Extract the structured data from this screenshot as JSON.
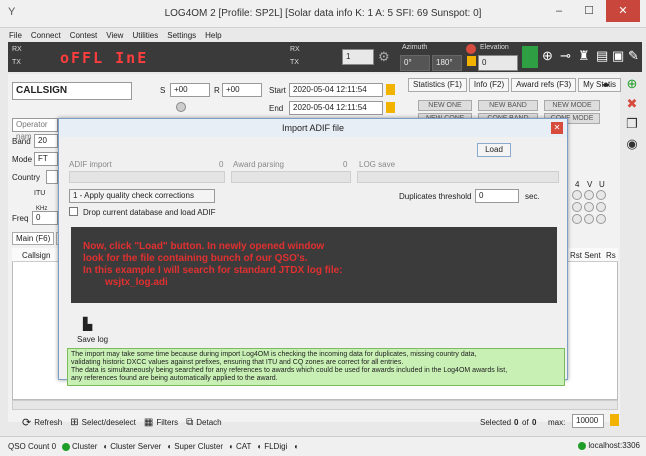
{
  "window": {
    "title": "LOG4OM 2 [Profile: SP2L] [Solar data info K: 1 A: 5 SFI: 69 Sunspot: 0]",
    "app_icon": "Y",
    "min": "–",
    "max": "☐",
    "close": "✕"
  },
  "menu": [
    "File",
    "Connect",
    "Contest",
    "View",
    "Utilities",
    "Settings",
    "Help"
  ],
  "toolbar": {
    "lcd": "oFFL InE",
    "rx": "RX",
    "tx": "TX",
    "step": "1",
    "azimuth_label": "Azimuth",
    "elevation_label": "Elevation",
    "az_1": "0°",
    "az_2": "180°",
    "elev_value": "0"
  },
  "form": {
    "callsign": "CALLSIGN",
    "s_label": "S",
    "s_value": "+00",
    "r_label": "R",
    "r_value": "+00",
    "start_label": "Start",
    "start_value": "2020-05-04 12:11:54",
    "end_label": "End",
    "end_value": "2020-05-04 12:11:54",
    "operator_placeholder": "Operator nam",
    "band_label": "Band",
    "band_value": "20",
    "mode_label": "Mode",
    "mode_value": "FT",
    "country_label": "Country",
    "itu_label": "ITU",
    "khz_label": "KHz",
    "freq_label": "Freq",
    "freq_value": "0",
    "main_tab": "Main (F6)",
    "main_tab_b": "F",
    "callsign_col": "Callsign",
    "rst_sent": "Rst Sent",
    "rs": "Rs"
  },
  "tabs": [
    "Statistics (F1)",
    "Info (F2)",
    "Award refs (F3)",
    "My Statis"
  ],
  "modes": [
    "NEW ONE",
    "NEW BAND",
    "NEW MODE",
    "NEW CONF",
    "CONF BAND",
    "CONF MODE"
  ],
  "dial_labels": [
    "4",
    "V",
    "U"
  ],
  "dialog": {
    "title": "Import ADIF file",
    "load": "Load",
    "adif_import": "ADIF import",
    "adif_count": "0",
    "award_parsing": "Award parsing",
    "award_count": "0",
    "log_save": "LOG save",
    "quality": "1 - Apply quality check corrections",
    "dup_label": "Duplicates threshold",
    "dup_value": "0",
    "sec": "sec.",
    "drop_label": "Drop current database and load ADIF",
    "instructions": [
      "Now, click \"Load\" button. In newly opened window",
      "look for the file containing bunch of our QSO's.",
      "In this example I will search for standard JTDX log file:",
      "wsjtx_log.adi"
    ],
    "save_log": "Save log",
    "info_lines": [
      "The import may take some time because during  import Log4OM is checking the incoming data for duplicates, missing country data,",
      "validating historic DXCC values against prefixes, ensuring that ITU and CQ zones are correct for all entries.",
      "The data is simultaneously being searched for any references to awards which could be used for awards included in the Log4OM awards list,",
      "any references found are being automatically applied to the award."
    ]
  },
  "bottom": {
    "refresh": "Refresh",
    "select": "Select/deselect",
    "filters": "Filters",
    "detach": "Detach",
    "selected_label": "Selected",
    "selected": "0",
    "of": "of",
    "total": "0",
    "max_label": "max:",
    "max_value": "10000"
  },
  "status": {
    "qso_count": "QSO Count  0",
    "cluster": "Cluster",
    "cluster_server": "Cluster Server",
    "super_cluster": "Super Cluster",
    "cat": "CAT",
    "fldigi": "FLDigi",
    "localhost": "localhost:3306"
  },
  "colors": {
    "accent": "#d64b3e",
    "lcd": "#ff3d3d",
    "info_bg": "#c8f0b4",
    "status_green": "#1e9e28"
  }
}
